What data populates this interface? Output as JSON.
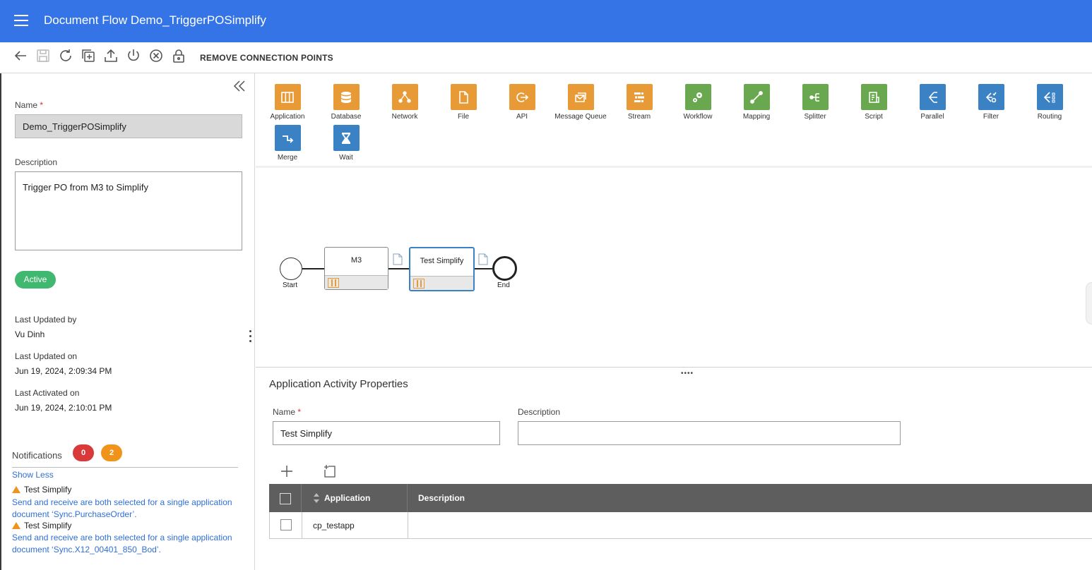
{
  "header": {
    "title": "Document Flow Demo_TriggerPOSimplify"
  },
  "toolbar": {
    "remove_connection_points": "REMOVE CONNECTION POINTS"
  },
  "left_panel": {
    "name_label": "Name",
    "name_value": "Demo_TriggerPOSimplify",
    "description_label": "Description",
    "description_value": "Trigger PO from M3 to Simplify",
    "status": "Active",
    "last_updated_by_label": "Last Updated by",
    "last_updated_by_value": "Vu Dinh",
    "last_updated_on_label": "Last Updated on",
    "last_updated_on_value": "Jun 19, 2024, 2:09:34 PM",
    "last_activated_on_label": "Last Activated on",
    "last_activated_on_value": "Jun 19, 2024, 2:10:01 PM",
    "notifications_label": "Notifications",
    "errors_count": "0",
    "warnings_count": "2",
    "show_less": "Show Less",
    "notifications": [
      {
        "title": "Test Simplify",
        "message": "Send and receive are both selected for a single application document ‘Sync.PurchaseOrder’."
      },
      {
        "title": "Test Simplify",
        "message": "Send and receive are both selected for a single application document ‘Sync.X12_00401_850_Bod’."
      }
    ]
  },
  "palette": [
    {
      "label": "Application",
      "icon": "application-icon",
      "color": "#e89a37"
    },
    {
      "label": "Database",
      "icon": "database-icon",
      "color": "#e89a37"
    },
    {
      "label": "Network",
      "icon": "network-icon",
      "color": "#e89a37"
    },
    {
      "label": "File",
      "icon": "file-icon",
      "color": "#e89a37"
    },
    {
      "label": "API",
      "icon": "api-icon",
      "color": "#e89a37"
    },
    {
      "label": "Message Queue",
      "icon": "message-queue-icon",
      "color": "#e89a37"
    },
    {
      "label": "Stream",
      "icon": "stream-icon",
      "color": "#e89a37"
    },
    {
      "label": "Workflow",
      "icon": "workflow-icon",
      "color": "#6aa84f"
    },
    {
      "label": "Mapping",
      "icon": "mapping-icon",
      "color": "#6aa84f"
    },
    {
      "label": "Splitter",
      "icon": "splitter-icon",
      "color": "#6aa84f"
    },
    {
      "label": "Script",
      "icon": "script-icon",
      "color": "#6aa84f"
    },
    {
      "label": "Parallel",
      "icon": "parallel-icon",
      "color": "#3a82c4"
    },
    {
      "label": "Filter",
      "icon": "filter-icon",
      "color": "#3a82c4"
    },
    {
      "label": "Routing",
      "icon": "routing-icon",
      "color": "#3a82c4"
    },
    {
      "label": "Merge",
      "icon": "merge-icon",
      "color": "#3a82c4"
    },
    {
      "label": "Wait",
      "icon": "wait-icon",
      "color": "#3a82c4"
    }
  ],
  "flow": {
    "start_label": "Start",
    "end_label": "End",
    "nodes": [
      {
        "name": "M3"
      },
      {
        "name": "Test Simplify"
      }
    ]
  },
  "properties": {
    "title": "Application Activity Properties",
    "name_label": "Name",
    "name_value": "Test Simplify",
    "description_label": "Description",
    "description_value": "",
    "table": {
      "columns": [
        "Application",
        "Description"
      ],
      "rows": [
        {
          "application": "cp_testapp",
          "description": ""
        }
      ]
    }
  }
}
